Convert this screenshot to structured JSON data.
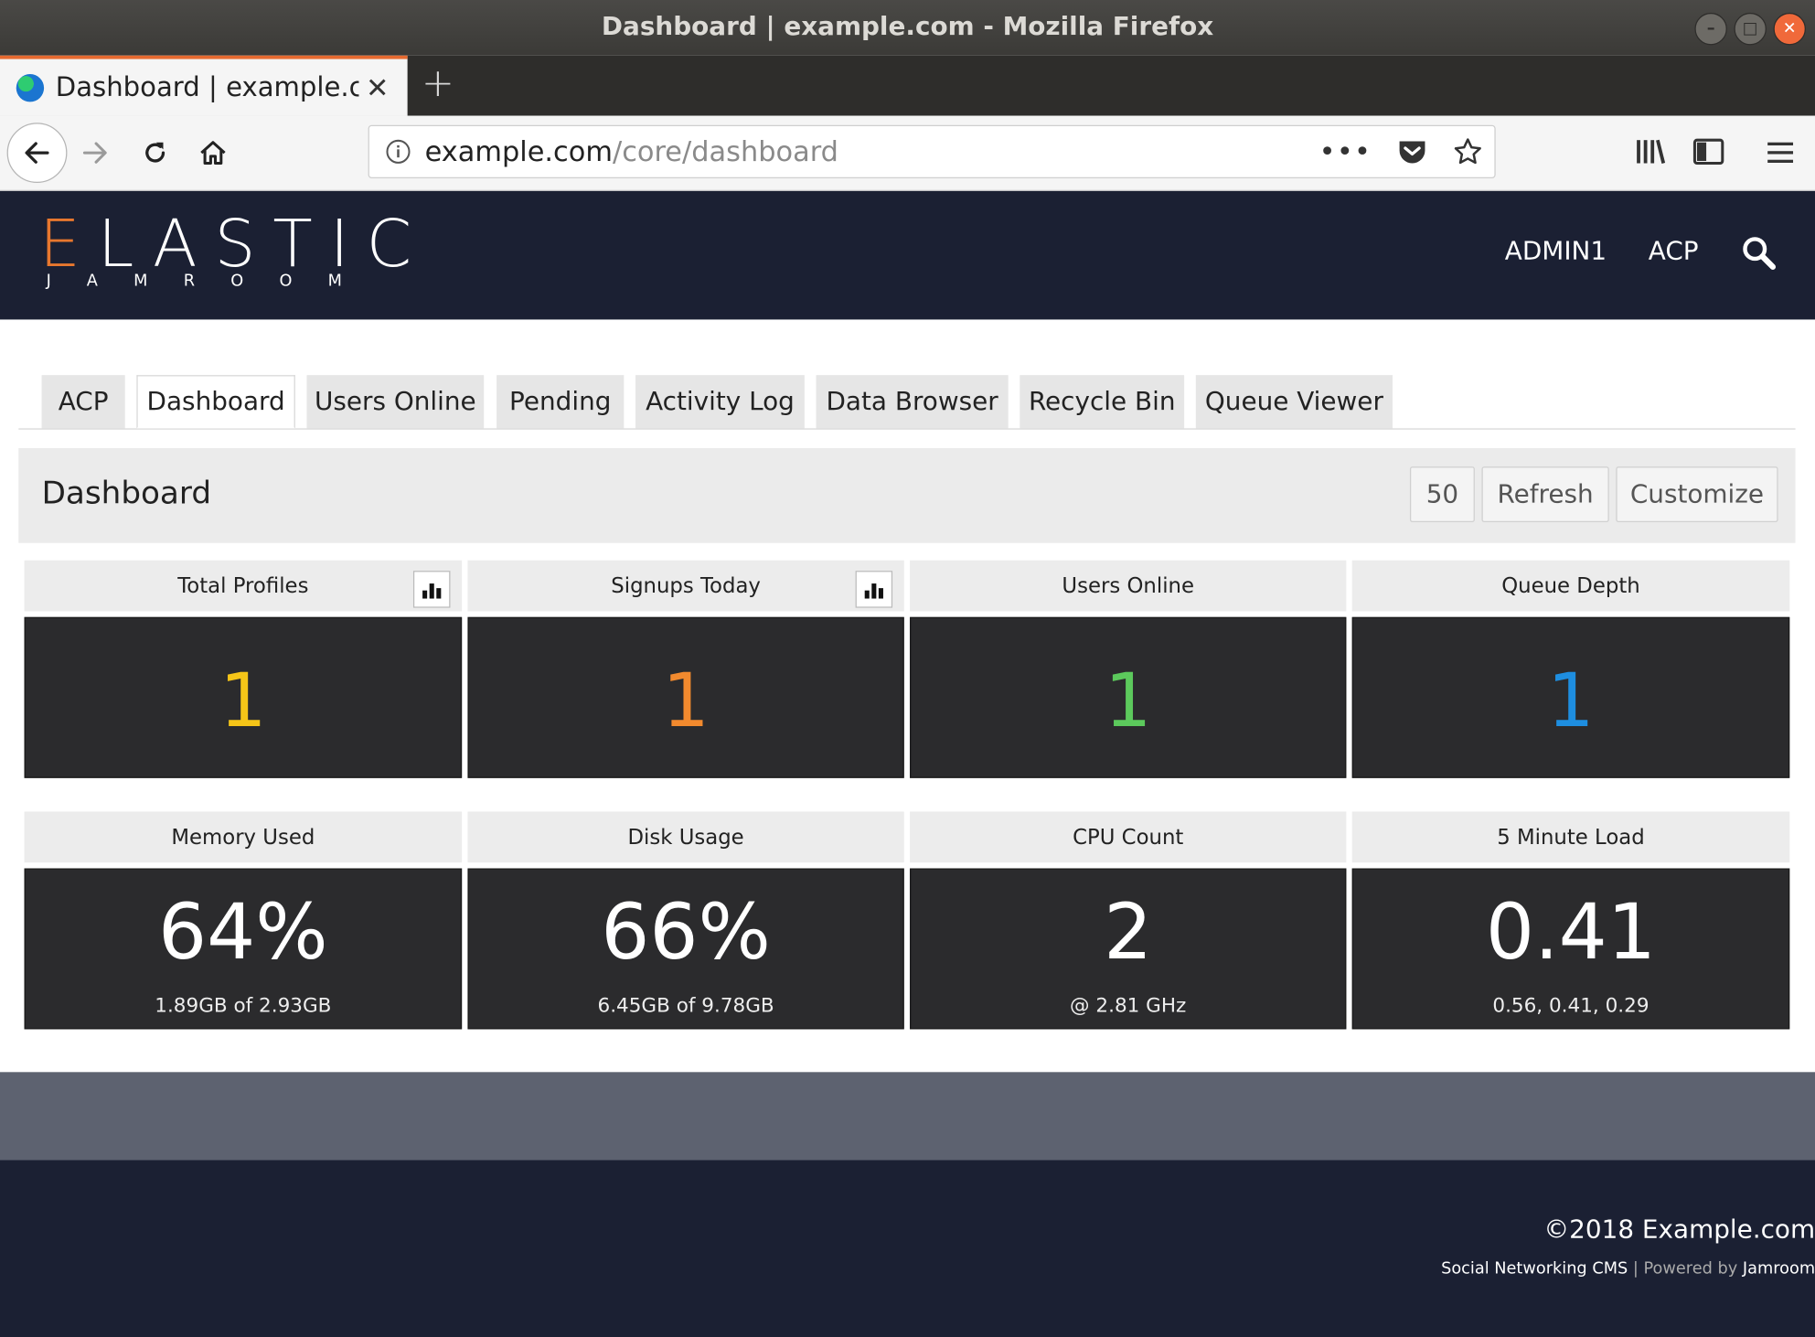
{
  "window": {
    "title": "Dashboard | example.com - Mozilla Firefox"
  },
  "browser": {
    "tab_title": "Dashboard | example.com",
    "url_host": "example.com",
    "url_path": "/core/dashboard"
  },
  "site": {
    "logo_main_first": "E",
    "logo_main_rest": "LASTIC",
    "logo_sub": "JAMROOM",
    "nav": {
      "user": "ADMIN1",
      "acp": "ACP"
    }
  },
  "tabs": [
    {
      "label": "ACP"
    },
    {
      "label": "Dashboard",
      "active": true
    },
    {
      "label": "Users Online"
    },
    {
      "label": "Pending"
    },
    {
      "label": "Activity Log"
    },
    {
      "label": "Data Browser"
    },
    {
      "label": "Recycle Bin"
    },
    {
      "label": "Queue Viewer"
    }
  ],
  "dashboard": {
    "title": "Dashboard",
    "buttons": {
      "count": "50",
      "refresh": "Refresh",
      "customize": "Customize"
    }
  },
  "cards": [
    {
      "title": "Total Profiles",
      "value": "1",
      "color": "#f5c518",
      "chart": true
    },
    {
      "title": "Signups Today",
      "value": "1",
      "color": "#f28a2e",
      "chart": true
    },
    {
      "title": "Users Online",
      "value": "1",
      "color": "#5cc95c",
      "chart": false
    },
    {
      "title": "Queue Depth",
      "value": "1",
      "color": "#1e8ee0",
      "chart": false
    },
    {
      "title": "Memory Used",
      "value": "64%",
      "sub": "1.89GB of 2.93GB"
    },
    {
      "title": "Disk Usage",
      "value": "66%",
      "sub": "6.45GB of 9.78GB"
    },
    {
      "title": "CPU Count",
      "value": "2",
      "sub": "@ 2.81 GHz"
    },
    {
      "title": "5 Minute Load",
      "value": "0.41",
      "sub": "0.56, 0.41, 0.29"
    }
  ],
  "footer": {
    "copyright": "©2018 Example.com",
    "tagline": "Social Networking CMS",
    "separator": "|",
    "powered": "Powered by",
    "powered_name": "Jamroom"
  }
}
